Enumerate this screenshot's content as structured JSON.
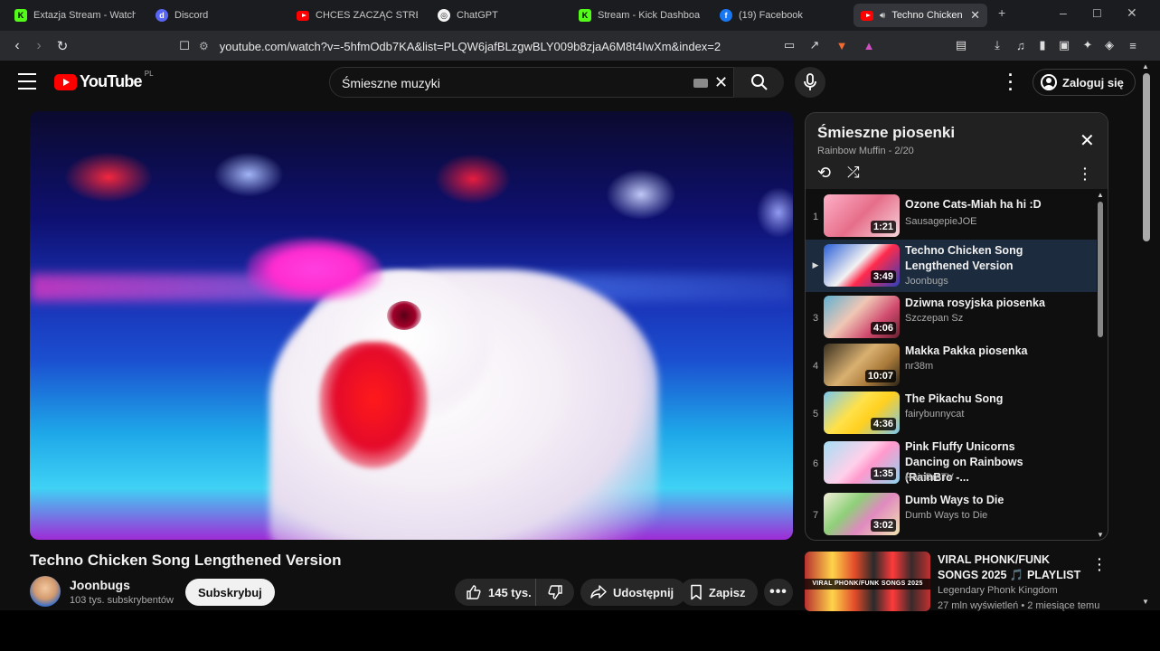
{
  "browser": {
    "tabs": [
      {
        "label": "Extazja Stream - Watch Li",
        "icon": "kick-icon"
      },
      {
        "label": "Discord",
        "icon": "discord-icon"
      },
      {
        "label": "CHCES ZACZĄĆ STREAM",
        "icon": "youtube-icon"
      },
      {
        "label": "ChatGPT",
        "icon": "chatgpt-icon"
      },
      {
        "label": "Stream - Kick Dashboard",
        "icon": "kick-icon"
      },
      {
        "label": "(19) Facebook",
        "icon": "facebook-icon"
      },
      {
        "label": "Techno Chicken So",
        "icon": "youtube-icon",
        "active": true
      }
    ],
    "url": "youtube.com/watch?v=-5hfmOdb7KA&list=PLQW6jafBLzgwBLY009b8zjaA6M8t4IwXm&index=2",
    "badges": {
      "brave": "10",
      "alerts": "1"
    }
  },
  "youtube": {
    "logo_text": "YouTube",
    "country_code": "PL",
    "search": {
      "value": "Śmieszne muzyki"
    },
    "sign_in": "Zaloguj się",
    "video": {
      "title": "Techno Chicken Song Lengthened Version",
      "channel": "Joonbugs",
      "subscribers": "103 tys. subskrybentów",
      "subscribe_label": "Subskrybuj",
      "likes": "145 tys.",
      "share_label": "Udostępnij",
      "save_label": "Zapisz"
    },
    "playlist": {
      "title": "Śmieszne piosenki",
      "subtitle": "Rainbow Muffin - 2/20",
      "items": [
        {
          "index": "1",
          "title": "Ozone Cats-Miah ha hi :D",
          "channel": "SausagepieJOE",
          "duration": "1:21"
        },
        {
          "index": "▶",
          "title": "Techno Chicken Song Lengthened Version",
          "channel": "Joonbugs",
          "duration": "3:49",
          "current": true
        },
        {
          "index": "3",
          "title": "Dziwna rosyjska piosenka",
          "channel": "Szczepan Sz",
          "duration": "4:06"
        },
        {
          "index": "4",
          "title": "Makka Pakka piosenka",
          "channel": "nr38m",
          "duration": "10:07"
        },
        {
          "index": "5",
          "title": "The Pikachu Song",
          "channel": "fairybunnycat",
          "duration": "4:36"
        },
        {
          "index": "6",
          "title": "Pink Fluffy Unicorns Dancing on Rainbows (RainBro -...",
          "channel": "RainBroTV",
          "duration": "1:35"
        },
        {
          "index": "7",
          "title": "Dumb Ways to Die",
          "channel": "Dumb Ways to Die",
          "duration": "3:02"
        }
      ]
    },
    "recommended": {
      "title": "VIRAL PHONK/FUNK SONGS 2025 🎵 PLAYLIST",
      "thumb_text": "VIRAL PHONK/FUNK SONGS 2025",
      "channel": "Legendary Phonk Kingdom",
      "meta": "27 mln wyświetleń • 2 miesiące temu"
    }
  },
  "colors": {
    "background": "#0f0f0f",
    "brand_red": "#ff0000",
    "current_item_bg": "#1c2b3d",
    "pill_bg": "#272727"
  }
}
